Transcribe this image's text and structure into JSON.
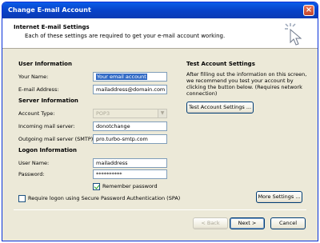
{
  "window": {
    "title": "Change E-mail Account",
    "close_glyph": "×"
  },
  "header": {
    "title": "Internet E-mail Settings",
    "subtitle": "Each of these settings are required to get your e-mail account working."
  },
  "user_info": {
    "section": "User Information",
    "name_label": "Your Name:",
    "name_value": "Your email account",
    "email_label": "E-mail Address:",
    "email_value": "mailaddress@domain.com"
  },
  "server_info": {
    "section": "Server Information",
    "account_type_label": "Account Type:",
    "account_type_value": "POP3",
    "incoming_label": "Incoming mail server:",
    "incoming_value": "donotchange",
    "outgoing_label": "Outgoing mail server (SMTP):",
    "outgoing_value": "pro.turbo-smtp.com"
  },
  "logon_info": {
    "section": "Logon Information",
    "username_label": "User Name:",
    "username_value": "mailaddress",
    "password_label": "Password:",
    "password_value": "**********",
    "remember_label": "Remember password",
    "remember_checked": true,
    "spa_label": "Require logon using Secure Password Authentication (SPA)",
    "spa_checked": false
  },
  "test": {
    "section": "Test Account Settings",
    "description": "After filling out the information on this screen, we recommend you test your account by clicking the button below. (Requires network connection)",
    "button": "Test Account Settings ..."
  },
  "more_settings": "More Settings ...",
  "footer": {
    "back": "< Back",
    "next": "Next >",
    "cancel": "Cancel"
  }
}
